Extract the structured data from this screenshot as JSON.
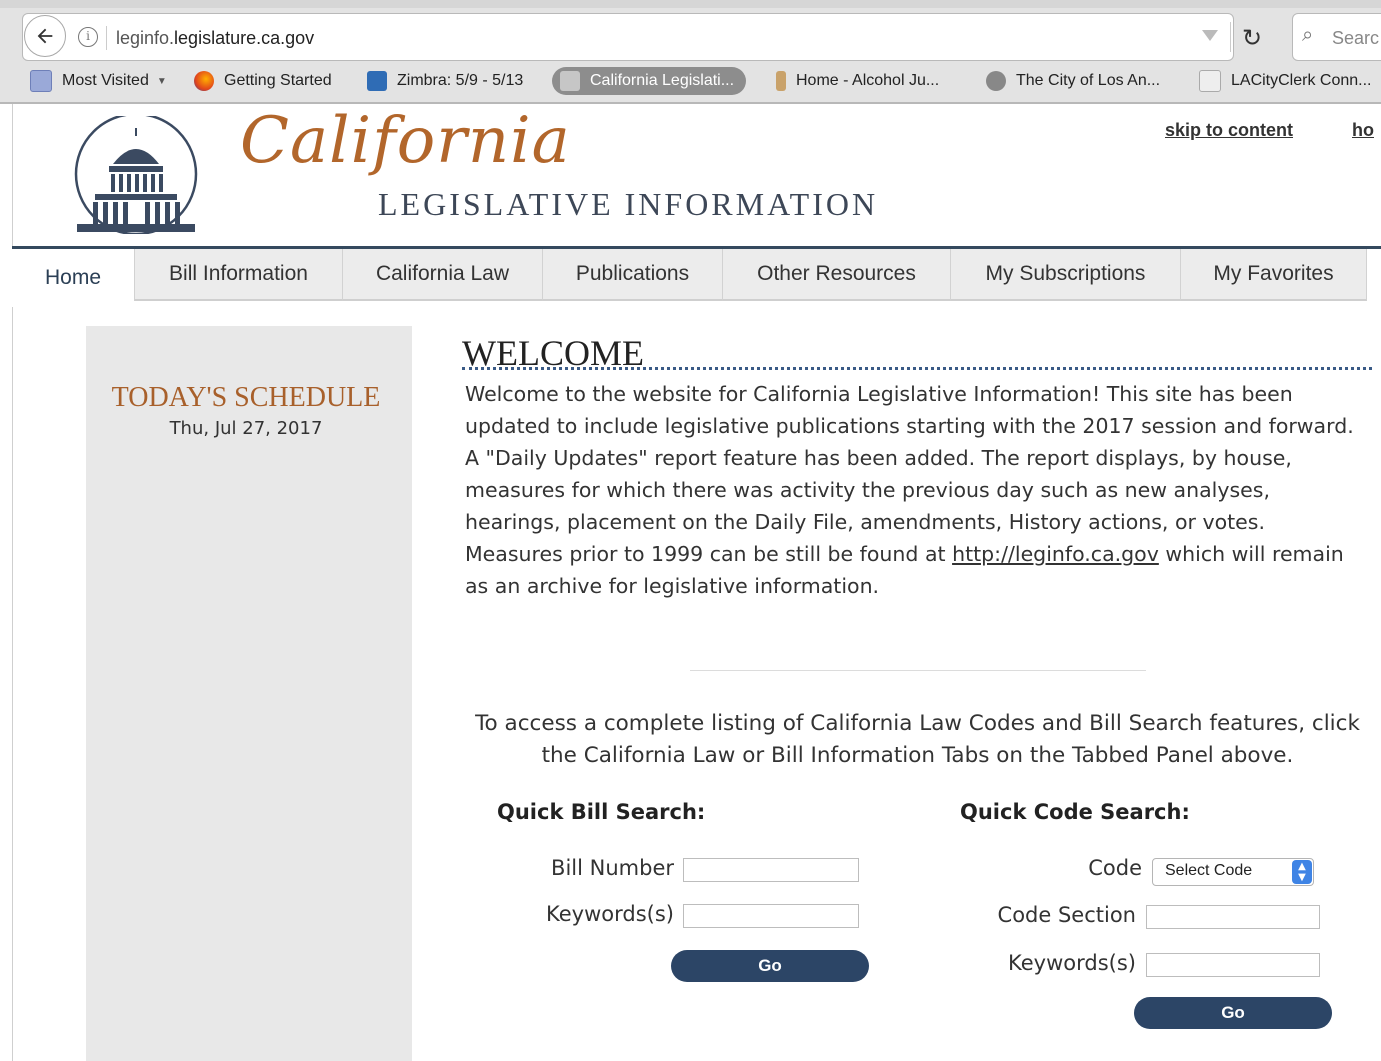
{
  "browser": {
    "url_prefix": "leginfo.",
    "url_domain": "legislature.ca.gov",
    "search_placeholder": "Searc",
    "bookmarks": [
      {
        "label": "Most Visited",
        "icon": "folder-icon"
      },
      {
        "label": "Getting Started",
        "icon": "firefox-icon"
      },
      {
        "label": "Zimbra: 5/9 - 5/13",
        "icon": "zimbra-icon"
      },
      {
        "label": "California Legislati...",
        "icon": "capitol-icon"
      },
      {
        "label": "Home - Alcohol Ju...",
        "icon": "alcohol-icon"
      },
      {
        "label": "The City of Los An...",
        "icon": "globe-icon"
      },
      {
        "label": "LACityClerk Conn...",
        "icon": "clerk-icon"
      }
    ]
  },
  "header": {
    "logo_script": "California",
    "logo_sub": "LEGISLATIVE INFORMATION",
    "skip_link": "skip to content",
    "home_link": "ho"
  },
  "nav": {
    "tabs": [
      "Home",
      "Bill Information",
      "California Law",
      "Publications",
      "Other Resources",
      "My Subscriptions",
      "My Favorites"
    ]
  },
  "sidebar": {
    "title": "TODAY'S SCHEDULE",
    "date": "Thu, Jul 27, 2017"
  },
  "main": {
    "welcome_title": "WELCOME",
    "welcome_p1": "Welcome to the website for California Legislative Information! This site has been updated to include legislative publications starting with the 2017 session and forward.",
    "welcome_p2": "A \"Daily Updates\" report feature has been added. The report displays, by house, measures for which there was activity the previous day such as new analyses, hearings, placement on the Daily File, amendments, History actions, or votes.",
    "welcome_p3_before": "Measures prior to 1999 can be still be found at ",
    "welcome_p3_link": "http://leginfo.ca.gov",
    "welcome_p3_after": " which will remain as an archive for legislative information.",
    "access_text": "To access a complete listing of California Law Codes and Bill Search features, click the California Law or Bill Information Tabs on the Tabbed Panel above."
  },
  "quick_bill": {
    "title": "Quick Bill Search:",
    "bill_number_label": "Bill Number",
    "keywords_label": "Keywords(s)",
    "go_label": "Go"
  },
  "quick_code": {
    "title": "Quick Code Search:",
    "code_label": "Code",
    "code_select_value": "Select Code",
    "section_label": "Code Section",
    "keywords_label": "Keywords(s)",
    "go_label": "Go"
  },
  "colors": {
    "accent_orange": "#b2662b",
    "nav_dark_blue": "#2c4566",
    "header_rule": "#34495e"
  }
}
